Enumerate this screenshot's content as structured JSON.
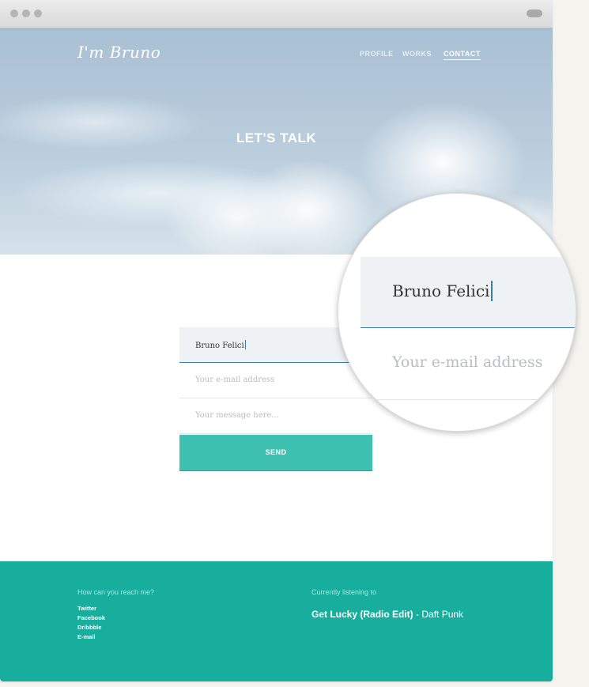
{
  "site": {
    "logo": "I'm Bruno",
    "nav": [
      {
        "label": "PROFILE",
        "active": false
      },
      {
        "label": "WORKS",
        "active": false
      },
      {
        "label": "CONTACT",
        "active": true
      }
    ],
    "hero_title": "LET'S TALK"
  },
  "form": {
    "name_value": "Bruno Felici",
    "email_placeholder": "Your e-mail address",
    "message_placeholder": "Your message here...",
    "send_label": "SEND"
  },
  "magnifier": {
    "name_value": "Bruno Felici",
    "email_placeholder": "Your e-mail address"
  },
  "footer": {
    "reach_heading": "How can you reach me?",
    "links": [
      "Twitter",
      "Facebook",
      "Dribbble",
      "E-mail"
    ],
    "listening_heading": "Currently listening to",
    "song_title": "Get Lucky (Radio Edit)",
    "song_artist": "- Daft Punk"
  },
  "colors": {
    "accent": "#3fc1b1",
    "footer_bg": "#18ae9d",
    "focus_border": "#3d7fa3"
  }
}
